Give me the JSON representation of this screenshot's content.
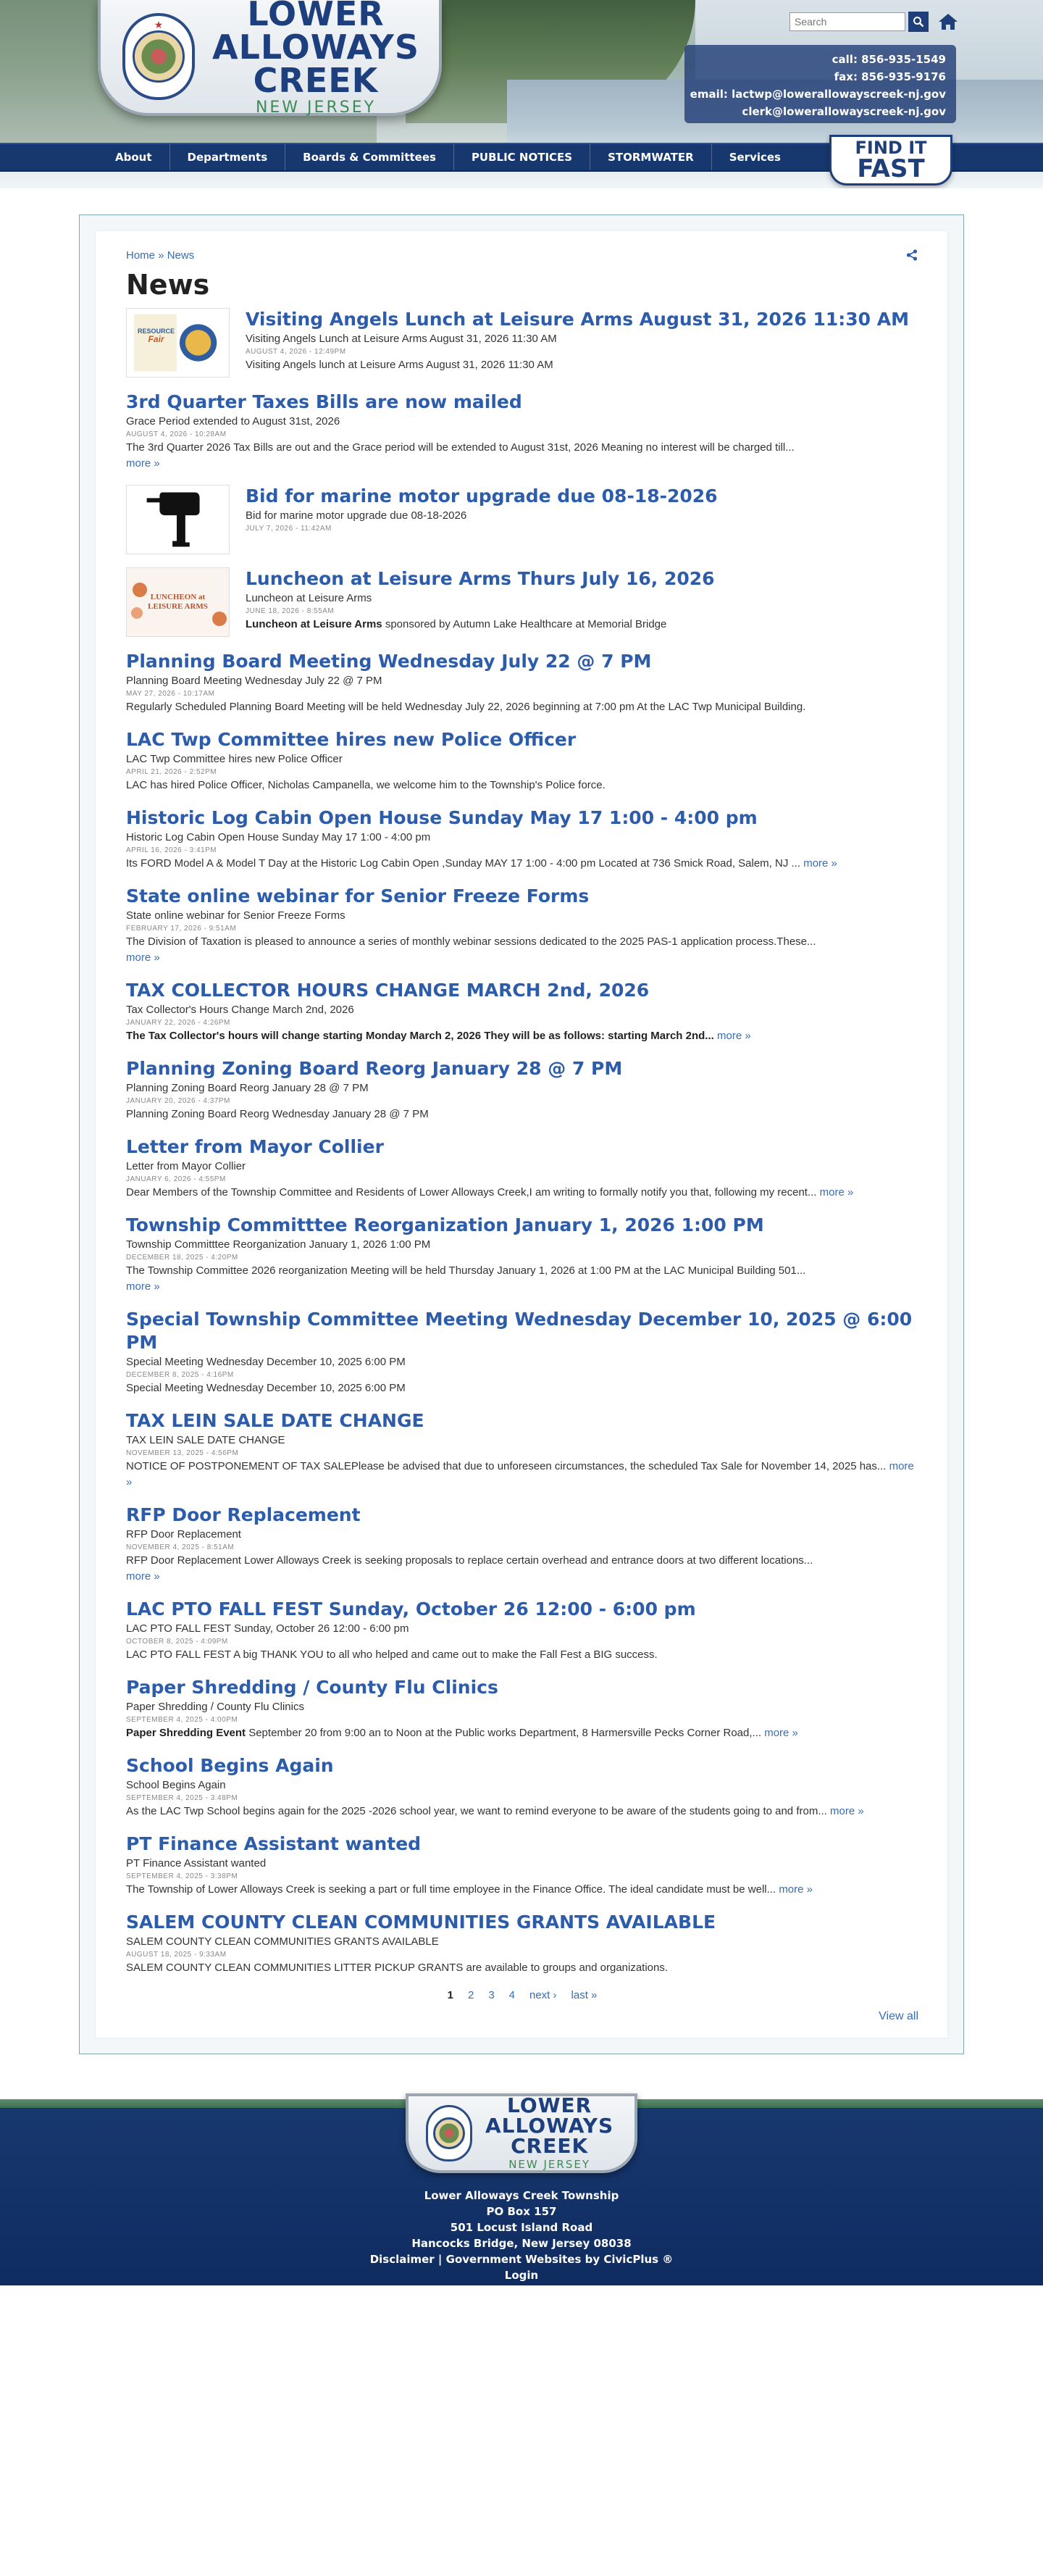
{
  "header": {
    "logo": {
      "line1": "LOWER",
      "line2": "ALLOWAYS",
      "line3": "CREEK",
      "sub": "NEW JERSEY"
    },
    "search": {
      "placeholder": "Search"
    },
    "contact": {
      "call": "call: 856-935-1549",
      "fax": "fax: 856-935-9176",
      "email1": "email: lactwp@lowerallowayscreek-nj.gov",
      "email2": "clerk@lowerallowayscreek-nj.gov"
    },
    "nav": [
      "About",
      "Departments",
      "Boards & Committees",
      "PUBLIC NOTICES",
      "STORMWATER",
      "Services"
    ],
    "find_it": {
      "line1": "FIND IT",
      "line2": "FAST"
    }
  },
  "breadcrumb": {
    "home": "Home",
    "sep": " » ",
    "current": "News"
  },
  "page_title": "News",
  "items": [
    {
      "title": "Visiting Angels Lunch at Leisure Arms August 31, 2026 11:30 AM",
      "sub": "Visiting Angels Lunch at Leisure Arms August 31, 2026 11:30 AM",
      "date": "AUGUST 4, 2026 - 12:49PM",
      "text_bold": "",
      "text": "Visiting Angels lunch at Leisure Arms August 31, 2026 11:30 AM",
      "more": ""
    },
    {
      "title": "3rd Quarter Taxes Bills are now mailed",
      "sub": "Grace Period extended to August 31st, 2026",
      "date": "AUGUST 4, 2026 - 10:28AM",
      "text_bold": "",
      "text": "The 3rd Quarter 2026 Tax Bills are out and the Grace period will be extended to August 31st, 2026 Meaning no interest will be charged till...",
      "more": "more »"
    },
    {
      "title": "Bid for marine motor upgrade due 08-18-2026",
      "sub": "Bid for marine motor upgrade due 08-18-2026",
      "date": "JULY 7, 2026 - 11:42AM",
      "text_bold": "",
      "text": "",
      "more": ""
    },
    {
      "title": "Luncheon at Leisure Arms Thurs July 16, 2026",
      "sub": "Luncheon at Leisure Arms",
      "date": "JUNE 18, 2026 - 8:55AM",
      "text_bold": "Luncheon at Leisure Arms",
      "text": " sponsored by Autumn Lake Healthcare at Memorial Bridge",
      "more": ""
    },
    {
      "title": "Planning Board Meeting Wednesday July 22 @ 7 PM",
      "sub": "Planning Board Meeting Wednesday July 22 @ 7 PM",
      "date": "MAY 27, 2026 - 10:17AM",
      "text_bold": "",
      "text": "Regularly Scheduled Planning Board Meeting will be held Wednesday July 22, 2026 beginning at 7:00 pm  At the LAC Twp Municipal Building.",
      "more": ""
    },
    {
      "title": "LAC Twp Committee hires new Police Officer",
      "sub": "LAC Twp Committee hires new Police Officer",
      "date": "APRIL 21, 2026 - 2:52PM",
      "text_bold": "",
      "text": "LAC has hired Police Officer, Nicholas Campanella, we welcome him to the Township's Police force.",
      "more": ""
    },
    {
      "title": "Historic Log Cabin Open House Sunday May 17 1:00 - 4:00 pm",
      "sub": "Historic Log Cabin Open House Sunday May 17 1:00 - 4:00 pm",
      "date": "APRIL 16, 2026 - 3:41PM",
      "text_bold": "",
      "text": " Its FORD Model A & Model T Day at the Historic Log Cabin Open ,Sunday MAY 17 1:00 - 4:00 pm  Located at 736 Smick Road, Salem, NJ ...",
      "more": "more »"
    },
    {
      "title": "State online webinar for Senior Freeze Forms",
      "sub": "State online webinar for Senior Freeze Forms",
      "date": "FEBRUARY 17, 2026 - 9:51AM",
      "text_bold": "",
      "text": "The Division of Taxation is pleased to announce a series of monthly webinar sessions dedicated to the 2025 PAS-1 application process.These...",
      "more": "more »"
    },
    {
      "title": "TAX COLLECTOR HOURS CHANGE MARCH 2nd, 2026",
      "sub": "Tax Collector's Hours Change March 2nd, 2026",
      "date": "JANUARY 22, 2026 - 4:26PM",
      "text_bold": "The Tax Collector's hours will change starting Monday March 2, 2026  They will be as follows: starting March 2nd...",
      "text": "",
      "more": "more »"
    },
    {
      "title": "Planning Zoning Board Reorg January 28 @ 7 PM",
      "sub": "Planning Zoning Board Reorg January 28 @ 7 PM",
      "date": "JANUARY 20, 2026 - 4:37PM",
      "text_bold": "",
      "text": " Planning Zoning Board Reorg Wednesday January 28 @ 7 PM",
      "more": ""
    },
    {
      "title": "Letter from Mayor Collier",
      "sub": "Letter from Mayor Collier",
      "date": "JANUARY 6, 2026 - 4:55PM",
      "text_bold": "",
      "text": "Dear Members of the Township Committee and Residents of Lower Alloways Creek,I am writing to formally notify you that, following my recent...",
      "more": "more »"
    },
    {
      "title": "Township Committtee Reorganization January 1, 2026 1:00 PM",
      "sub": "Township Committtee Reorganization January 1, 2026 1:00 PM",
      "date": "DECEMBER 18, 2025 - 4:20PM",
      "text_bold": "",
      "text": "The Township Committee 2026 reorganization Meeting will be held Thursday January 1, 2026 at 1:00 PM at the LAC Municipal Building 501...",
      "more": "more »"
    },
    {
      "title": "Special Township Committee Meeting Wednesday December 10, 2025 @ 6:00 PM",
      "sub": "Special Meeting Wednesday December 10, 2025 6:00 PM",
      "date": "DECEMBER 8, 2025 - 4:16PM",
      "text_bold": "",
      "text": "Special Meeting Wednesday December 10, 2025  6:00 PM",
      "more": ""
    },
    {
      "title": "TAX LEIN SALE DATE CHANGE",
      "sub": "TAX LEIN SALE DATE CHANGE",
      "date": "NOVEMBER 13, 2025 - 4:56PM",
      "text_bold": "",
      "text": "NOTICE OF POSTPONEMENT OF TAX SALEPlease be advised that due to unforeseen circumstances, the scheduled Tax Sale for November 14, 2025 has...",
      "more": "more »"
    },
    {
      "title": "RFP Door Replacement",
      "sub": "RFP Door Replacement",
      "date": "NOVEMBER 4, 2025 - 8:51AM",
      "text_bold": "",
      "text": "RFP Door Replacement  Lower Alloways Creek is seeking proposals to replace certain overhead and entrance doors at two different locations...",
      "more": "more »"
    },
    {
      "title": "LAC PTO FALL FEST Sunday, October 26 12:00 - 6:00 pm",
      "sub": "LAC PTO FALL FEST Sunday, October 26 12:00 - 6:00 pm",
      "date": "OCTOBER 8, 2025 - 4:09PM",
      "text_bold": "",
      "text": "LAC PTO FALL FEST   A big THANK YOU to all who helped and came out to make the Fall Fest a BIG success.",
      "more": ""
    },
    {
      "title": "Paper Shredding / County Flu Clinics",
      "sub": "Paper Shredding / County Flu Clinics",
      "date": "SEPTEMBER 4, 2025 - 4:00PM",
      "text_bold": "Paper Shredding Event",
      "text": " September 20 from 9:00 an to Noon at the Public works Department, 8 Harmersville Pecks Corner Road,...",
      "more": "more »"
    },
    {
      "title": "School Begins Again",
      "sub": "School Begins Again",
      "date": "SEPTEMBER 4, 2025 - 3:48PM",
      "text_bold": "",
      "text": "As the LAC Twp School begins again for the 2025 -2026 school year, we want to remind everyone to be aware of the students going to and from...",
      "more": "more »"
    },
    {
      "title": "PT Finance Assistant wanted",
      "sub": "PT Finance Assistant wanted",
      "date": "SEPTEMBER 4, 2025 - 3:38PM",
      "text_bold": "",
      "text": "The Township of Lower Alloways Creek is seeking a part or full time employee in the Finance Office. The ideal candidate must be well...",
      "more": "more »"
    },
    {
      "title": "SALEM COUNTY CLEAN COMMUNITIES GRANTS AVAILABLE",
      "sub": "SALEM COUNTY CLEAN COMMUNITIES GRANTS AVAILABLE",
      "date": "AUGUST 18, 2025 - 9:33AM",
      "text_bold": "",
      "text": "SALEM COUNTY CLEAN COMMUNITIES LITTER PICKUP GRANTS are available to groups and organizations.",
      "more": ""
    }
  ],
  "thumbs": {
    "resource_fair": {
      "line1": "RESOURCE",
      "line2": "Fair"
    },
    "luncheon": {
      "line1": "LUNCHEON at",
      "line2": "LEISURE ARMS"
    }
  },
  "pager": {
    "pages": [
      "1",
      "2",
      "3",
      "4"
    ],
    "next": "next ›",
    "last": "last »"
  },
  "view_all": "View all",
  "footer": {
    "name": "Lower Alloways Creek Township",
    "po": "PO Box 157",
    "street": "501 Locust Island Road",
    "city": "Hancocks Bridge, New Jersey 08038",
    "links": "Disclaimer | Government Websites by CivicPlus ®",
    "login": "Login"
  },
  "colors": {
    "navy": "#17386f",
    "link": "#2c5caa",
    "green": "#3f8a57"
  }
}
